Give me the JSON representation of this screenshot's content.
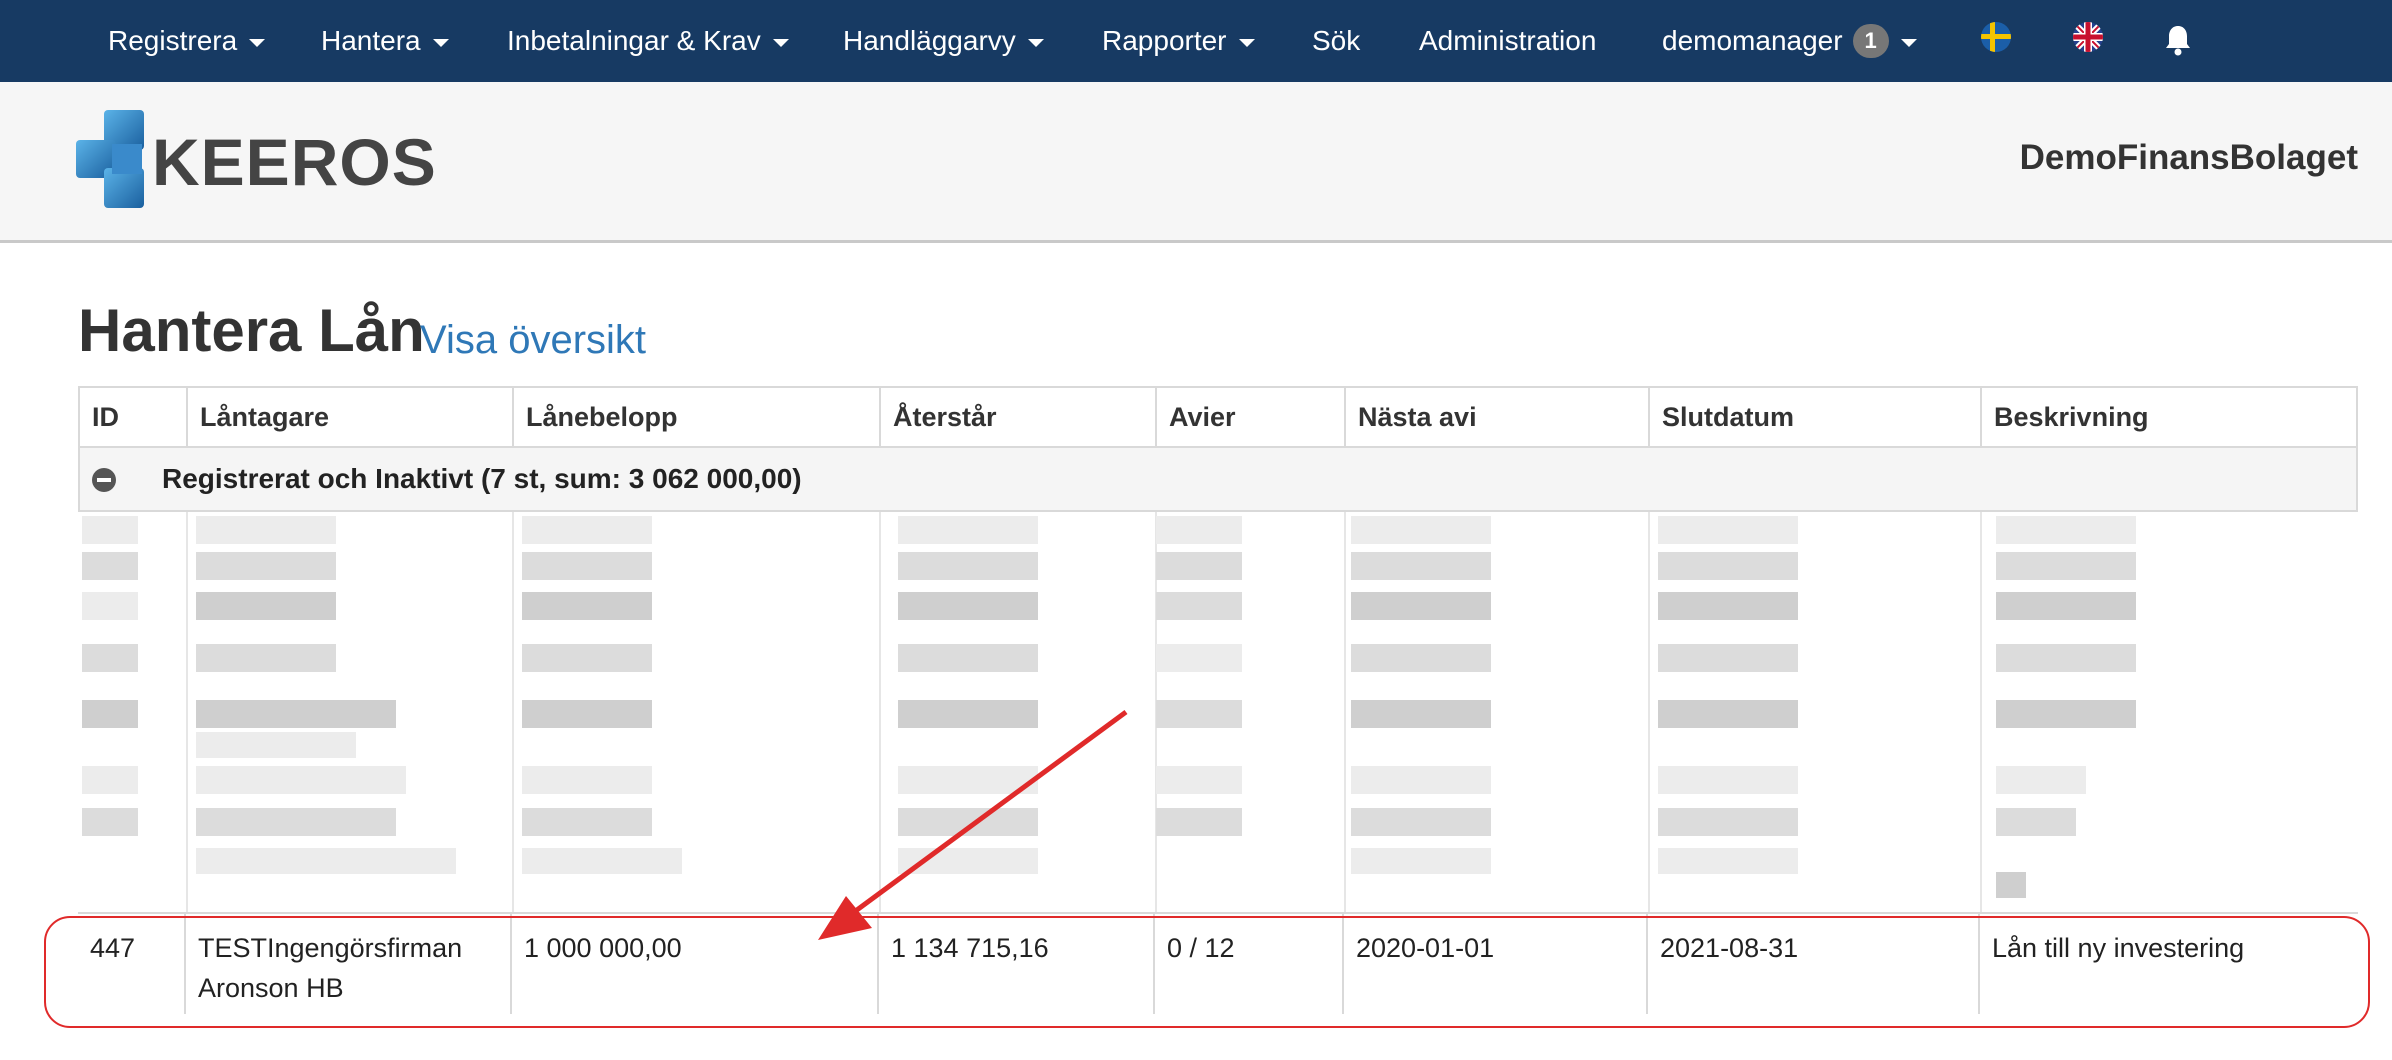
{
  "nav": {
    "items": [
      {
        "label": "Registrera",
        "caret": true
      },
      {
        "label": "Hantera",
        "caret": true
      },
      {
        "label": "Inbetalningar & Krav",
        "caret": true
      },
      {
        "label": "Handläggarvy",
        "caret": true
      },
      {
        "label": "Rapporter",
        "caret": true
      },
      {
        "label": "Sök",
        "caret": false
      },
      {
        "label": "Administration",
        "caret": false
      }
    ],
    "user": "demomanager",
    "user_badge": "1"
  },
  "header": {
    "logo_text": "KEEROS",
    "company": "DemoFinansBolaget"
  },
  "page": {
    "title": "Hantera Lån",
    "overview_link": "Visa översikt"
  },
  "table": {
    "columns": [
      "ID",
      "Låntagare",
      "Lånebelopp",
      "Återstår",
      "Avier",
      "Nästa avi",
      "Slutdatum",
      "Beskrivning"
    ],
    "group_label": "Registrerat och Inaktivt (7 st, sum: 3 062 000,00)",
    "highlighted_row": {
      "id": "447",
      "borrower": "TESTIngengörsfirman Aronson HB",
      "amount": "1 000 000,00",
      "remaining": "1 134 715,16",
      "notices": "0 / 12",
      "next_notice": "2020-01-01",
      "end_date": "2021-08-31",
      "description": "Lån till ny investering"
    }
  },
  "colors": {
    "nav_bg": "#173a63",
    "link": "#2f78b7",
    "annotation": "#e02a2a"
  }
}
